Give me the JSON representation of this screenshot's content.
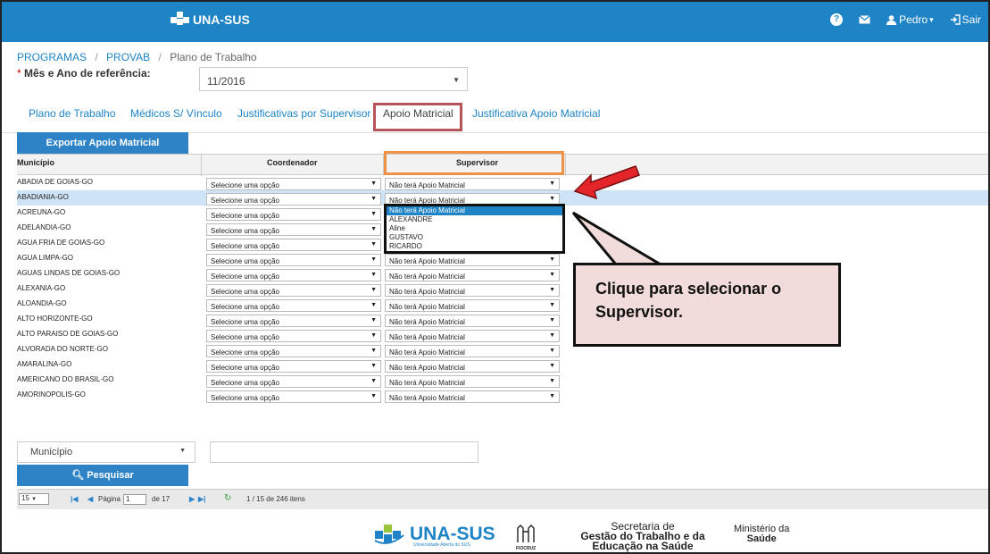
{
  "header": {
    "brand": "UNA-SUS",
    "help_icon": "question-circle-icon",
    "mail_icon": "envelope-icon",
    "user_label": "Pedro",
    "user_caret": "▾",
    "logout_label": "Sair"
  },
  "breadcrumb": [
    "PROGRAMAS",
    "PROVAB",
    "Plano de Trabalho"
  ],
  "reference": {
    "required_mark": "*",
    "label": "Mês e Ano de referência:",
    "value": "11/2016"
  },
  "tabs": [
    {
      "label": "Plano de Trabalho",
      "active": false
    },
    {
      "label": "Médicos S/ Vínculo",
      "active": false
    },
    {
      "label": "Justificativas por Supervisor",
      "active": false
    },
    {
      "label": "Apoio Matricial",
      "active": true
    },
    {
      "label": "Justificativa Apoio Matricial",
      "active": false
    }
  ],
  "export_button": "Exportar Apoio Matricial",
  "grid": {
    "columns": [
      "Município",
      "Coordenador",
      "Supervisor"
    ],
    "rows": [
      {
        "municipio": "ABADIA DE GOIAS-GO",
        "coordenador": "Selecione uma opção",
        "supervisor": "Não terá Apoio Matricial",
        "selected": false
      },
      {
        "municipio": "ABADIANIA-GO",
        "coordenador": "Selecione uma opção",
        "supervisor": "Não terá Apoio Matricial",
        "selected": true
      },
      {
        "municipio": "ACREUNA-GO",
        "coordenador": "Selecione uma opção",
        "supervisor": "",
        "selected": false
      },
      {
        "municipio": "ADELANDIA-GO",
        "coordenador": "Selecione uma opção",
        "supervisor": "",
        "selected": false
      },
      {
        "municipio": "AGUA FRIA DE GOIAS-GO",
        "coordenador": "Selecione uma opção",
        "supervisor": "",
        "selected": false
      },
      {
        "municipio": "AGUA LIMPA-GO",
        "coordenador": "Selecione uma opção",
        "supervisor": "Não terá Apoio Matricial",
        "selected": false
      },
      {
        "municipio": "AGUAS LINDAS DE GOIAS-GO",
        "coordenador": "Selecione uma opção",
        "supervisor": "Não terá Apoio Matricial",
        "selected": false
      },
      {
        "municipio": "ALEXANIA-GO",
        "coordenador": "Selecione uma opção",
        "supervisor": "Não terá Apoio Matricial",
        "selected": false
      },
      {
        "municipio": "ALOANDIA-GO",
        "coordenador": "Selecione uma opção",
        "supervisor": "Não terá Apoio Matricial",
        "selected": false
      },
      {
        "municipio": "ALTO HORIZONTE-GO",
        "coordenador": "Selecione uma opção",
        "supervisor": "Não terá Apoio Matricial",
        "selected": false
      },
      {
        "municipio": "ALTO PARAISO DE GOIAS-GO",
        "coordenador": "Selecione uma opção",
        "supervisor": "Não terá Apoio Matricial",
        "selected": false
      },
      {
        "municipio": "ALVORADA DO NORTE-GO",
        "coordenador": "Selecione uma opção",
        "supervisor": "Não terá Apoio Matricial",
        "selected": false
      },
      {
        "municipio": "AMARALINA-GO",
        "coordenador": "Selecione uma opção",
        "supervisor": "Não terá Apoio Matricial",
        "selected": false
      },
      {
        "municipio": "AMERICANO DO BRASIL-GO",
        "coordenador": "Selecione uma opção",
        "supervisor": "Não terá Apoio Matricial",
        "selected": false
      },
      {
        "municipio": "AMORINOPOLIS-GO",
        "coordenador": "Selecione uma opção",
        "supervisor": "Não terá Apoio Matricial",
        "selected": false
      }
    ]
  },
  "dropdown_options": [
    "Não terá Apoio Matricial",
    "ALEXANDRE",
    "Aline",
    "GUSTAVO",
    "RICARDO"
  ],
  "callout": "Clique para selecionar o Supervisor.",
  "filter": {
    "field_value": "Município",
    "search_button": "Pesquisar"
  },
  "pager": {
    "page_size": "15",
    "page_label": "Página",
    "page_value": "1",
    "of_label": "de 17",
    "summary": "1 / 15 de 246 itens"
  },
  "footer": {
    "brand": "UNA-SUS",
    "brand_sub": "Universidade Aberta do SUS",
    "fiocruz": "FIOCRUZ",
    "secretaria_line1": "Secretaria de",
    "secretaria_line2": "Gestão do Trabalho e da",
    "secretaria_line3": "Educação na Saúde",
    "ministerio_line1": "Ministério da",
    "ministerio_line2": "Saúde"
  },
  "colors": {
    "primary": "#1e84c6",
    "tab_highlight": "#b5555a",
    "supervisor_highlight": "#ee9144",
    "arrow": "#e4262b",
    "callout_fill": "#f2dcdb"
  }
}
